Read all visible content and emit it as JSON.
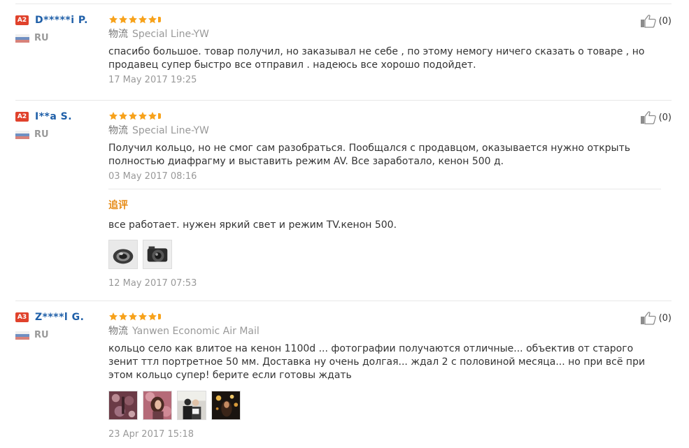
{
  "reviews": [
    {
      "user": {
        "level": "A2",
        "name": "D*****i P.",
        "country": "RU"
      },
      "rating": 5,
      "shipping": {
        "label": "物流",
        "method": "Special Line-YW"
      },
      "text": "спасибо большое. товар получил, но заказывал не себе , по этому немогу ничего сказать о товаре , но продавец супер быстро все отправил . надеюсь все хорошо подойдет.",
      "date": "17 May 2017 19:25",
      "helpful_count": "(0)"
    },
    {
      "user": {
        "level": "A2",
        "name": "I**a S.",
        "country": "RU"
      },
      "rating": 5,
      "shipping": {
        "label": "物流",
        "method": "Special Line-YW"
      },
      "text": "Получил кольцо, но не смог сам разобраться. Пообщался с продавцом, оказывается нужно открыть полностью диафрагму и выставить режим AV. Все заработало, кенон 500 д.",
      "date": "03 May 2017 08:16",
      "helpful_count": "(0)",
      "additional": {
        "label": "追评",
        "text": "все работает. нужен яркий свет и режим TV.кенон 500.",
        "photos": [
          "lens-ring-photo",
          "camera-with-ring-photo"
        ],
        "date": "12 May 2017 07:53"
      }
    },
    {
      "user": {
        "level": "A3",
        "name": "Z****l G.",
        "country": "RU"
      },
      "rating": 5,
      "shipping": {
        "label": "物流",
        "method": "Yanwen Economic Air Mail"
      },
      "text": "кольцо село как влитое на кенон 1100d ... фотографии получаются отличные... объектив от старого зенит ттл портретное 50 мм. Доставка ну очень долгая... ждал 2 с половиной месяца... но при всё при этом кольцо супер! берите если готовы ждать",
      "date": "23 Apr 2017 15:18",
      "helpful_count": "(0)",
      "photos": [
        "floral-background-photo",
        "portrait-woman-photo",
        "couple-photo",
        "night-lights-photo"
      ]
    }
  ],
  "colors": {
    "star": "#f7a21b",
    "badge": "#e0422c",
    "username": "#1f5fa8",
    "additional_label": "#e68a14"
  }
}
